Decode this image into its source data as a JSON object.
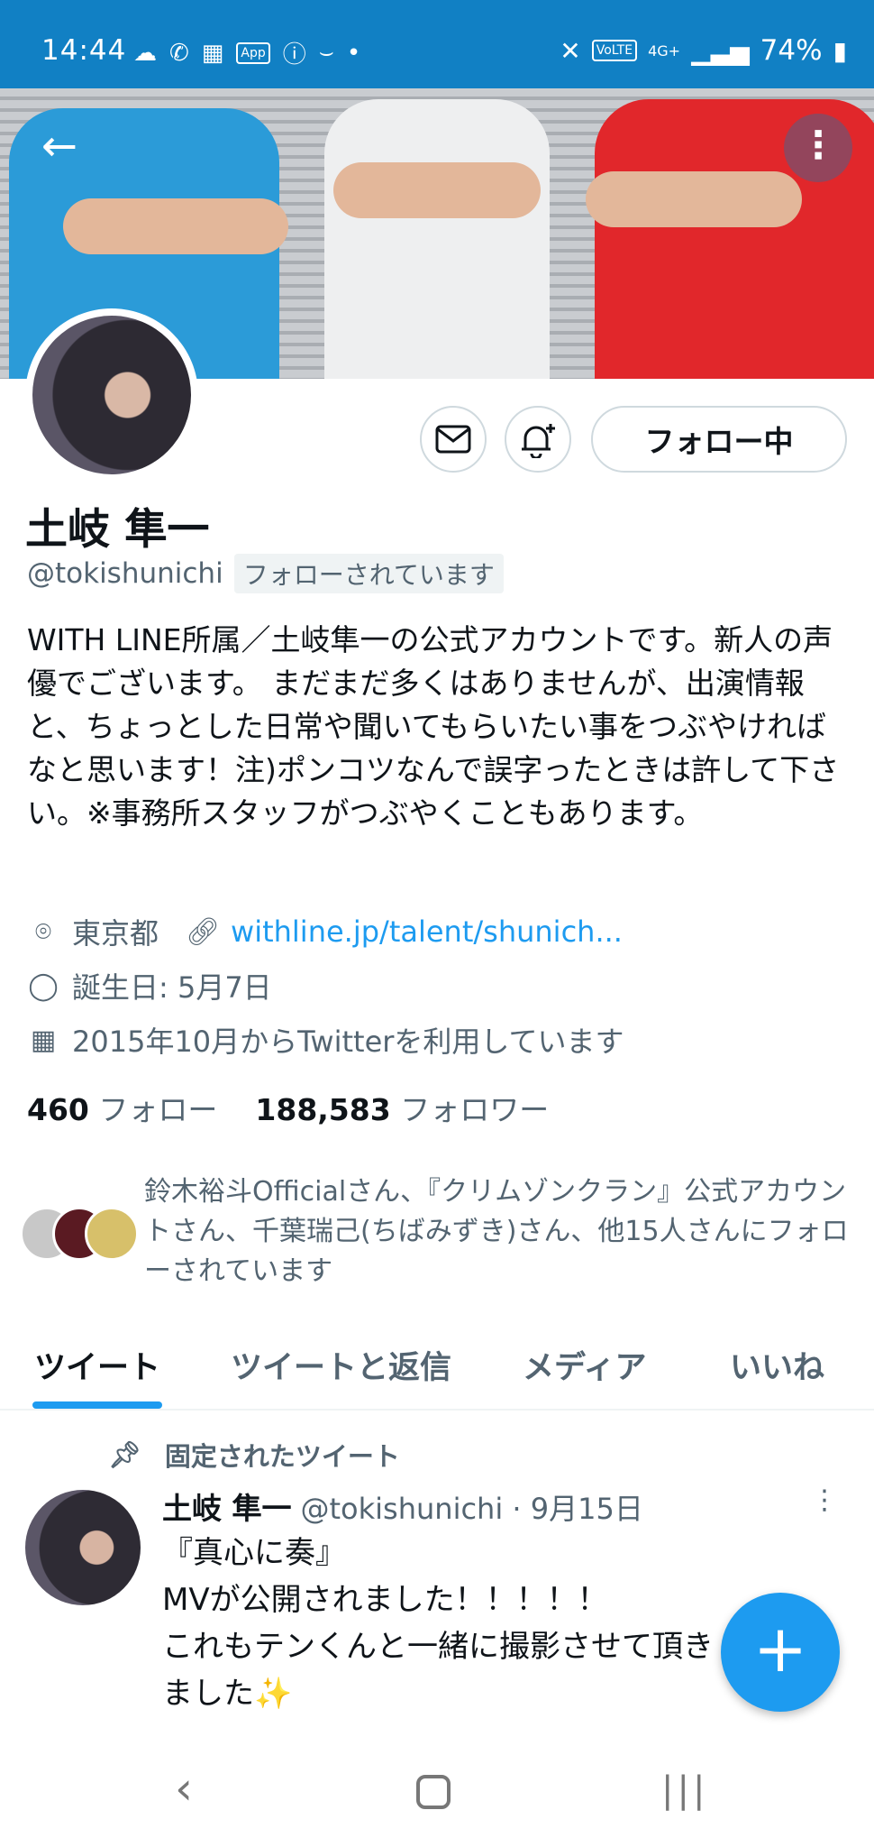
{
  "status_bar": {
    "time": "14:44",
    "battery": "74%",
    "icons_left": [
      "weather-icon",
      "wifi-call-icon",
      "calendar-icon",
      "app-icon",
      "info-icon",
      "amazon-icon",
      "dot-icon"
    ],
    "icons_right": [
      "mute-icon",
      "volte-icon",
      "4g-icon",
      "signal-icon",
      "battery-icon"
    ],
    "volte_label": "VoLTE",
    "net_label": "4G+",
    "app_label": "App"
  },
  "profile": {
    "name": "土岐 隼一",
    "handle": "@tokishunichi",
    "follows_you": "フォローされています",
    "follow_button": "フォロー中",
    "bio": "WITH LINE所属／土岐隼一の公式アカウントです。新人の声優でございます。 まだまだ多くはありませんが、出演情報と、ちょっとした日常や聞いてもらいたい事をつぶやければなと思います！注)ポンコツなんで誤字ったときは許して下さい。※事務所スタッフがつぶやくこともあります。",
    "location": "東京都",
    "website": "withline.jp/talent/shunich...",
    "birthday": "誕生日: 5月7日",
    "joined": "2015年10月からTwitterを利用しています",
    "following_count": "460",
    "following_label": "フォロー",
    "followers_count": "188,583",
    "followers_label": "フォロワー",
    "followed_by": "鈴木裕斗Officialさん、『クリムゾンクラン』公式アカウントさん、千葉瑞己(ちばみずき)さん、他15人さんにフォローされています"
  },
  "tabs": [
    {
      "label": "ツイート",
      "active": true
    },
    {
      "label": "ツイートと返信",
      "active": false
    },
    {
      "label": "メディア",
      "active": false
    },
    {
      "label": "いいね",
      "active": false
    }
  ],
  "pinned_tweet": {
    "pinned_label": "固定されたツイート",
    "name": "土岐 隼一",
    "handle_date": "@tokishunichi · 9月15日",
    "text": "『真心に奏』\nMVが公開されました！！！！！\nこれもテンくんと一緒に撮影させて頂きました✨"
  },
  "colors": {
    "status_bar": "#1180c4",
    "accent": "#1d9bf0",
    "text_primary": "#0f1419",
    "text_secondary": "#536471"
  }
}
